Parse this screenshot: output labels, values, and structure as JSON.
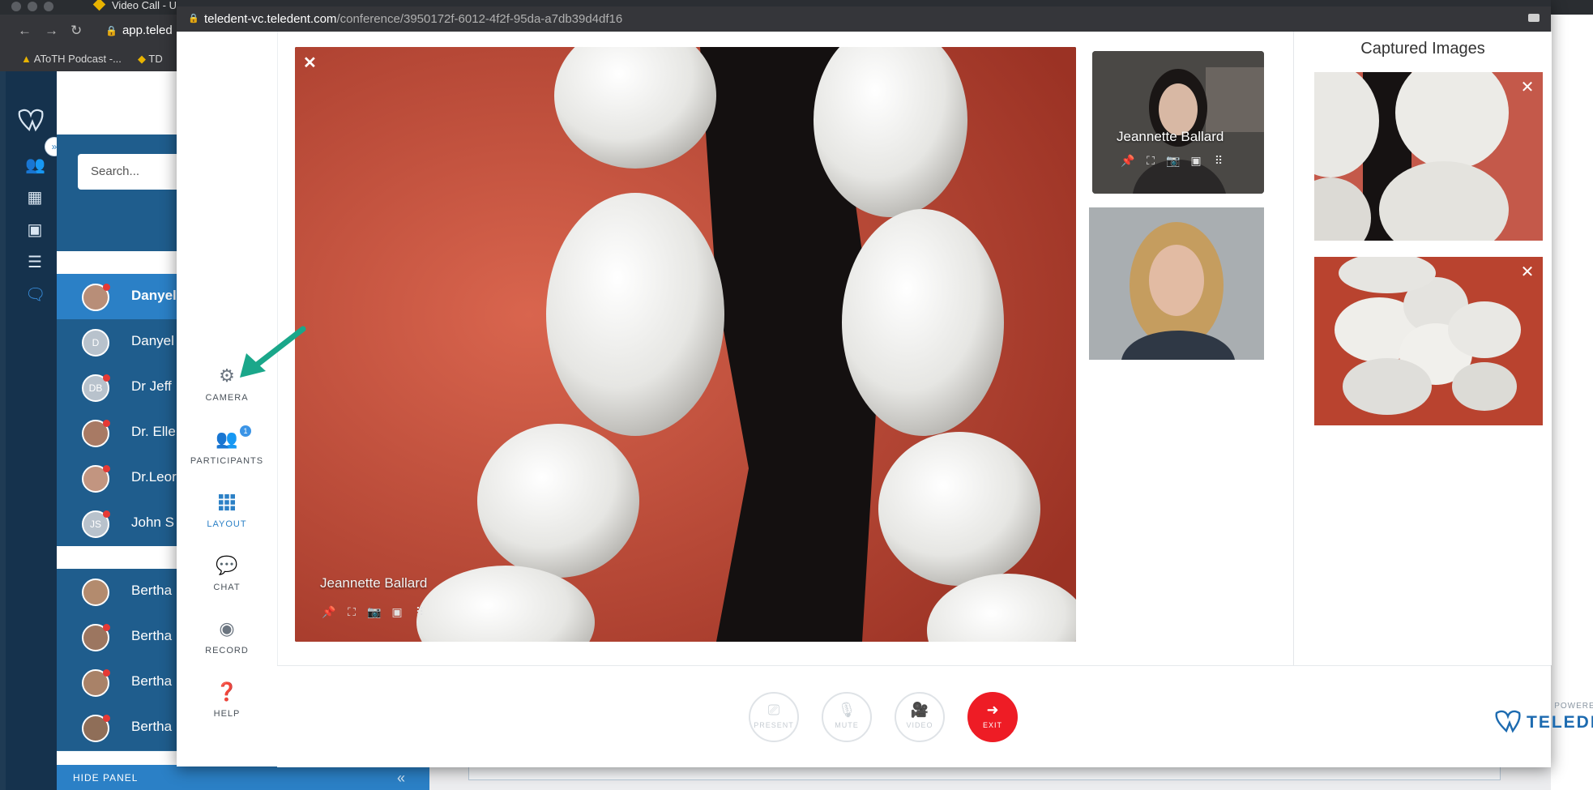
{
  "browser_bg": {
    "tab_title": "Video Call - U",
    "url": "app.teled",
    "bookmarks": [
      "AToTH Podcast -...",
      "TD"
    ],
    "search_placeholder": "Search...",
    "contacts": [
      {
        "name": "Danyel",
        "initials": "",
        "active": true
      },
      {
        "name": "Danyel",
        "initials": "D",
        "active": false
      },
      {
        "name": "Dr Jeff",
        "initials": "DB",
        "active": false
      },
      {
        "name": "Dr. Elle",
        "initials": "",
        "active": false
      },
      {
        "name": "Dr.Leor",
        "initials": "",
        "active": false
      },
      {
        "name": "John S",
        "initials": "JS",
        "active": false
      },
      {
        "name": "Bertha",
        "initials": "",
        "active": false
      },
      {
        "name": "Bertha",
        "initials": "",
        "active": false
      },
      {
        "name": "Bertha",
        "initials": "",
        "active": false
      },
      {
        "name": "Bertha",
        "initials": "",
        "active": false
      }
    ],
    "hide_panel_label": "HIDE PANEL",
    "hide_panel_chevron": "«",
    "nav_icons": [
      "logo-icon",
      "users-icon",
      "calendar-icon",
      "briefcase-icon",
      "checklist-icon",
      "chat-icon"
    ]
  },
  "popup": {
    "url_host": "teledent-vc.teledent.com",
    "url_path": "/conference/3950172f-6012-4f2f-95da-a7db39d4df16"
  },
  "menu": {
    "camera": "CAMERA",
    "participants": "PARTICIPANTS",
    "participants_badge": "1",
    "layout": "LAYOUT",
    "chat": "CHAT",
    "record": "RECORD",
    "help": "HELP",
    "active": "layout"
  },
  "video": {
    "main_name": "Jeannette Ballard",
    "thumb1_name": "Jeannette Ballard",
    "close_glyph": "✕"
  },
  "captured": {
    "title": "Captured Images",
    "close_glyph": "✕",
    "expand_glyph": "»"
  },
  "controls": {
    "present": "PRESENT",
    "mute": "MUTE",
    "video": "VIDEO",
    "exit": "EXIT"
  },
  "branding": {
    "powered_by": "POWERED BY",
    "brand": "TELEDENT"
  },
  "colors": {
    "accent": "#2b80c6",
    "sidebar_dark": "#15324d",
    "exit_red": "#ee1c25",
    "arrow_green": "#1aa78a"
  }
}
